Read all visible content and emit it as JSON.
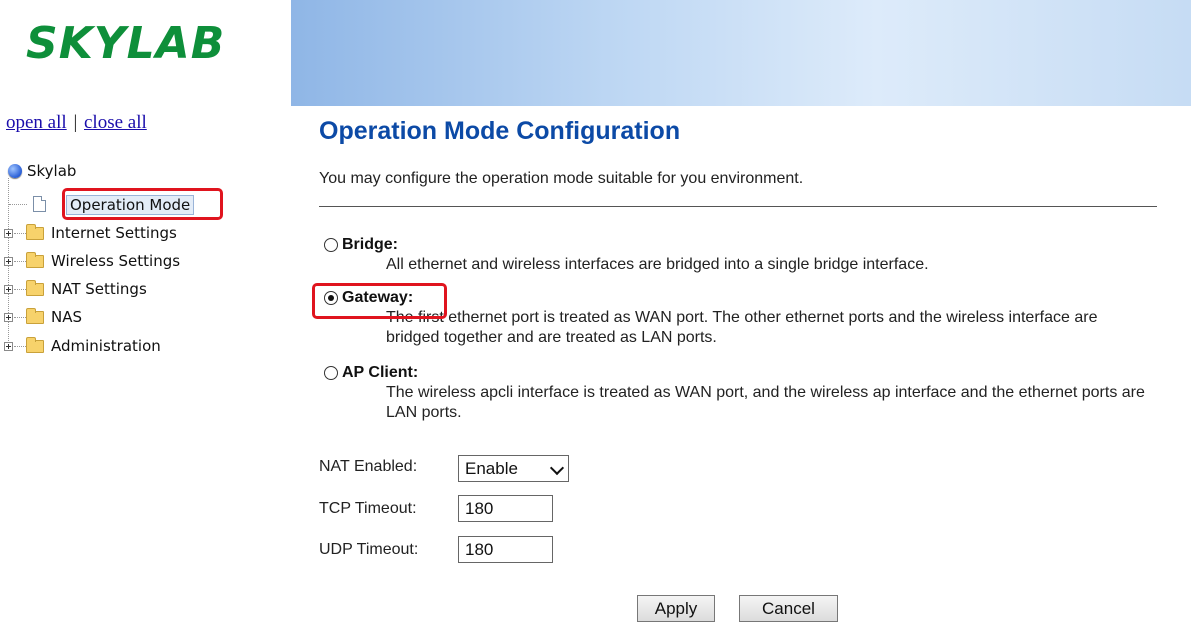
{
  "logo": "SKYLAB",
  "nav": {
    "open_all": "open all",
    "separator": "|",
    "close_all": "close all"
  },
  "tree": {
    "root": "Skylab",
    "items": [
      {
        "label": "Operation Mode",
        "icon": "page-icon",
        "selected": true
      },
      {
        "label": "Internet Settings",
        "icon": "folder-icon"
      },
      {
        "label": "Wireless Settings",
        "icon": "folder-icon"
      },
      {
        "label": "NAT Settings",
        "icon": "folder-icon"
      },
      {
        "label": "NAS",
        "icon": "folder-icon"
      },
      {
        "label": "Administration",
        "icon": "folder-icon"
      }
    ]
  },
  "page": {
    "title": "Operation Mode Configuration",
    "intro": "You may configure the operation mode suitable for you environment."
  },
  "modes": [
    {
      "label": "Bridge:",
      "desc": "All ethernet and wireless interfaces are bridged into a single bridge interface.",
      "checked": false
    },
    {
      "label": "Gateway:",
      "desc": "The first ethernet port is treated as WAN port. The other ethernet ports and the wireless interface are bridged together and are treated as LAN ports.",
      "checked": true
    },
    {
      "label": "AP Client:",
      "desc": "The wireless apcli interface is treated as WAN port, and the wireless ap interface and the ethernet ports are LAN ports.",
      "checked": false
    }
  ],
  "fields": {
    "nat_label": "NAT Enabled:",
    "nat_value": "Enable",
    "tcp_label": "TCP Timeout:",
    "tcp_value": "180",
    "udp_label": "UDP Timeout:",
    "udp_value": "180"
  },
  "buttons": {
    "apply": "Apply",
    "cancel": "Cancel"
  },
  "colors": {
    "highlight": "#e0141e",
    "title": "#0c4aa6",
    "logo": "#0e8f3a"
  }
}
